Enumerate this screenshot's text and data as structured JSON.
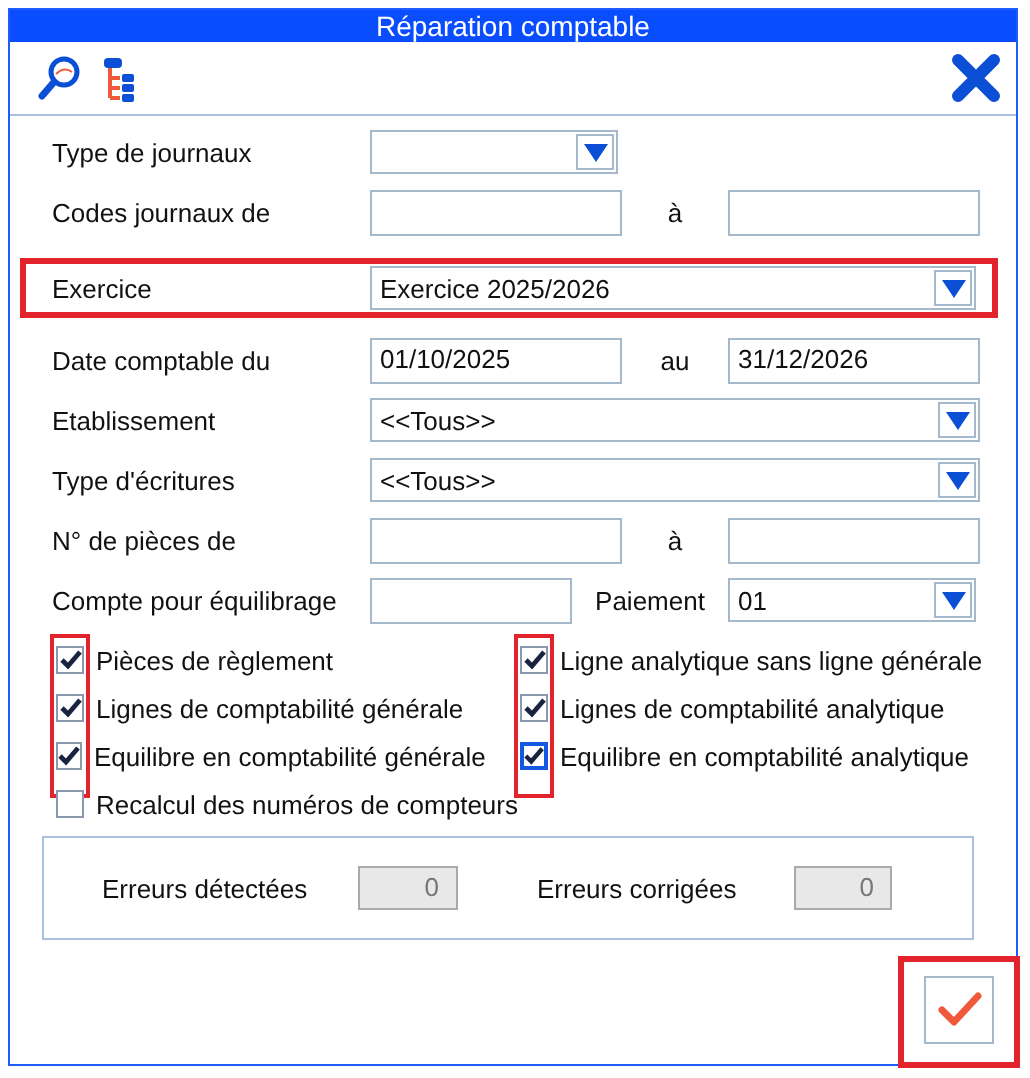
{
  "window": {
    "title": "Réparation comptable"
  },
  "fields": [
    {
      "kind": "combo_short",
      "label": "Type de journaux",
      "highlighted": false
    },
    {
      "kind": "range",
      "label": "Codes journaux de",
      "separator": "à"
    },
    {
      "kind": "combo",
      "label": "Exercice",
      "value": "Exercice 2025/2026",
      "highlighted": true
    },
    {
      "kind": "range",
      "label": "Date comptable du",
      "value": "01/10/2025",
      "separator": "au",
      "value2": "31/12/2026"
    },
    {
      "kind": "combo",
      "label": "Etablissement",
      "value": "<<Tous>>",
      "highlighted": false
    },
    {
      "kind": "combo",
      "label": "Type d'écritures",
      "value": "<<Tous>>",
      "highlighted": false
    },
    {
      "kind": "range",
      "label": "N° de pièces de",
      "separator": "à"
    },
    {
      "kind": "account",
      "label": "Compte pour équilibrage",
      "label2": "Paiement",
      "value2": "01"
    }
  ],
  "check_columns": [
    {
      "highlighted": true,
      "items": [
        {
          "label": "Pièces de règlement",
          "checked": true,
          "focused": false
        },
        {
          "label": "Lignes de comptabilité générale",
          "checked": true,
          "focused": false
        },
        {
          "label": "Equilibre en comptabilité générale",
          "checked": true,
          "focused": false
        }
      ]
    },
    {
      "highlighted": true,
      "items": [
        {
          "label": "Ligne analytique sans ligne générale",
          "checked": true,
          "focused": false
        },
        {
          "label": "Lignes de comptabilité analytique",
          "checked": true,
          "focused": false
        },
        {
          "label": "Equilibre en comptabilité analytique",
          "checked": true,
          "focused": true
        }
      ]
    }
  ],
  "recalc": {
    "label": "Recalcul des numéros de compteurs",
    "checked": false
  },
  "errors": [
    {
      "label": "Erreurs détectées",
      "value": "0"
    },
    {
      "label": "Erreurs corrigées",
      "value": "0"
    }
  ],
  "ok_button": {
    "highlighted": true
  }
}
